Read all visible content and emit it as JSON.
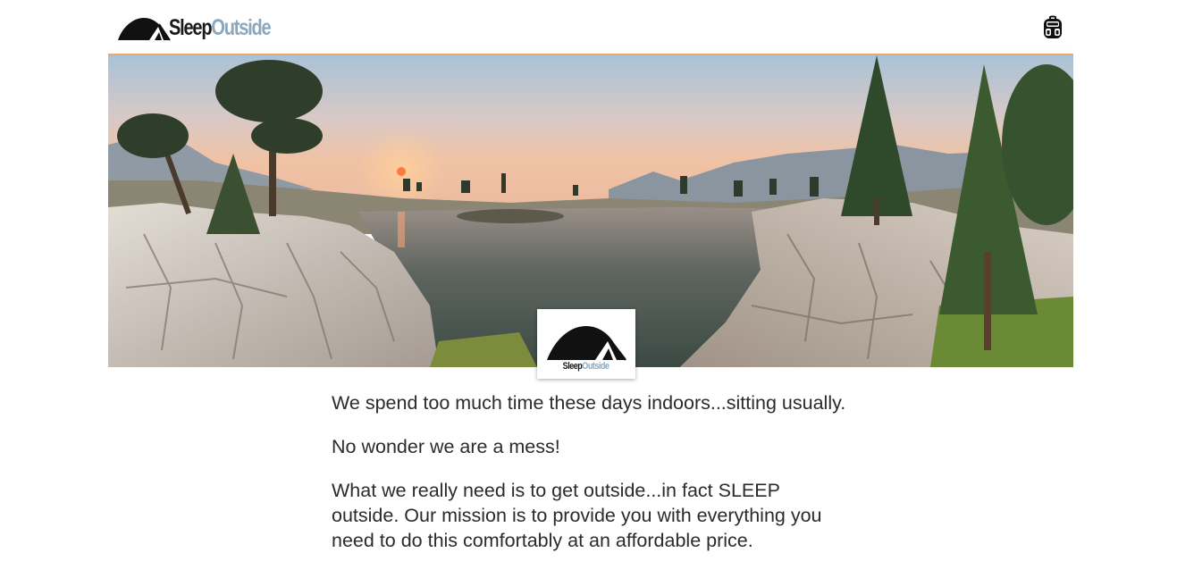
{
  "header": {
    "logo": {
      "word1": "Sleep",
      "word2": "Outside",
      "icon": "tent-icon"
    },
    "cart_icon": "backpack-icon"
  },
  "hero": {
    "image": "mountain-lake-sunset-photo",
    "badge": {
      "word1": "Sleep",
      "word2": "Outside",
      "icon": "tent-icon"
    }
  },
  "content": {
    "paragraphs": [
      "We spend too much time these days indoors...sitting usually.",
      "No wonder we are a mess!",
      "What we really need is to get outside...in fact SLEEP outside. Our mission is to provide you with everything you need to do this comfortably at an affordable price."
    ]
  },
  "colors": {
    "accent_border": "#f0a868",
    "logo_dark": "#1a1a1a",
    "logo_light": "#8aa7bd",
    "text": "#2b2b2b"
  }
}
